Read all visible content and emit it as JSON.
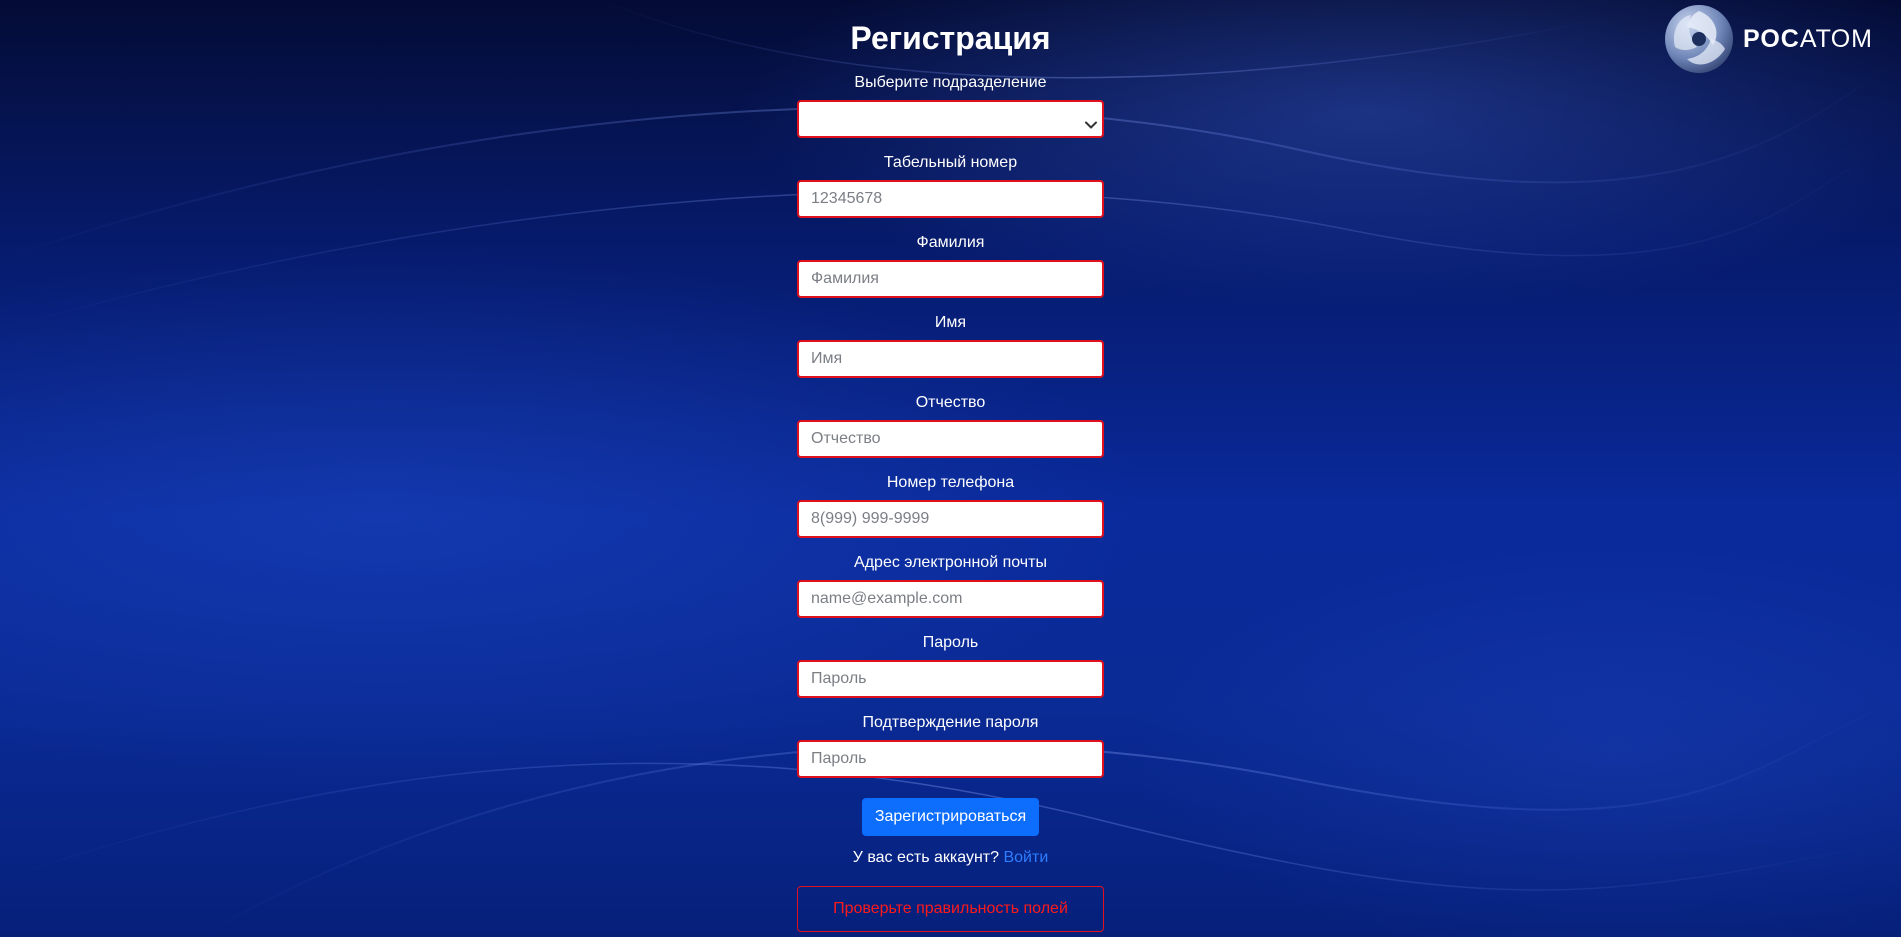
{
  "page": {
    "title": "Регистрация"
  },
  "logo": {
    "word_bold": "РОС",
    "word_regular": "АТОМ",
    "icon": "rosatom-logo-icon"
  },
  "form": {
    "department": {
      "label": "Выберите подразделение",
      "value": ""
    },
    "employee_number": {
      "label": "Табельный номер",
      "placeholder": "12345678",
      "value": ""
    },
    "last_name": {
      "label": "Фамилия",
      "placeholder": "Фамилия",
      "value": ""
    },
    "first_name": {
      "label": "Имя",
      "placeholder": "Имя",
      "value": ""
    },
    "patronymic": {
      "label": "Отчество",
      "placeholder": "Отчество",
      "value": ""
    },
    "phone": {
      "label": "Номер телефона",
      "placeholder": "8(999) 999-9999",
      "value": ""
    },
    "email": {
      "label": "Адрес электронной почты",
      "placeholder": "name@example.com",
      "value": ""
    },
    "password": {
      "label": "Пароль",
      "placeholder": "Пароль",
      "value": ""
    },
    "password_confirm": {
      "label": "Подтверждение пароля",
      "placeholder": "Пароль",
      "value": ""
    },
    "submit_label": "Зарегистрироваться",
    "account_prompt": "У вас есть аккаунт?",
    "login_link": "Войти",
    "error_message": "Проверьте правильность полей"
  },
  "colors": {
    "invalid_border": "#e0101d",
    "primary_button": "#0d6efd",
    "link": "#2e7dff",
    "error_text": "#ff1a1a",
    "background": "#061a6e"
  }
}
